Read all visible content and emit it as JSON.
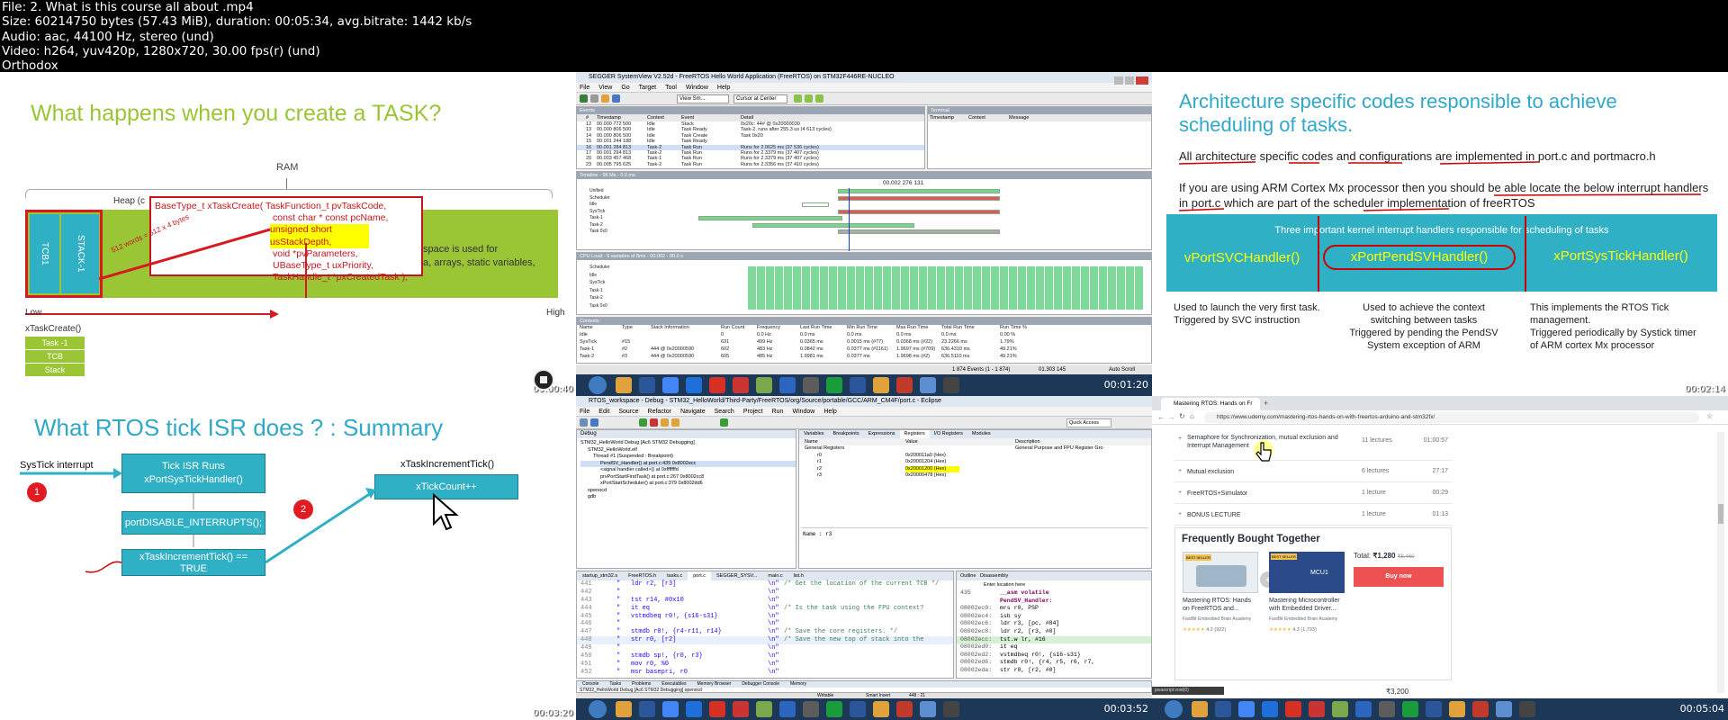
{
  "header": {
    "lines": [
      "File: 2. What is this course all about .mp4",
      "Size: 60214750 bytes (57.43 MiB), duration: 00:05:34, avg.bitrate: 1442 kb/s",
      "Audio: aac, 44100 Hz, stereo (und)",
      "Video: h264, yuv420p, 1280x720, 30.00 fps(r) (und)",
      "Orthodox"
    ]
  },
  "colors": {
    "slide_green": "#9ac534",
    "slide_blue": "#30b0c4",
    "taskbar": "#1d3757",
    "buy": "#ec5252",
    "arrow_red": "#d71920"
  },
  "thumb1": {
    "timestamp": "00:00:40",
    "title": "What happens when you create a TASK?",
    "ram": "RAM",
    "heap": "Heap (c",
    "tcb": "TCB1",
    "stack": "STACK-1",
    "code": [
      "BaseType_t xTaskCreate( TaskFunction_t pvTaskCode,",
      "const char * const pcName,",
      "unsigned short usStackDepth,",
      "void *pvParameters,",
      "UBaseType_t uxPriority,",
      "TaskHandle_t *pxCreatedTask );"
    ],
    "words": "512 words = 512 x 4 bytes",
    "space_text": [
      "space is used for",
      "a, arrays, static variables,"
    ],
    "low": "Low",
    "high": "High",
    "fn": "xTaskCreate()",
    "mini": [
      "Task -1",
      "TCB",
      "Stack"
    ]
  },
  "thumb2": {
    "timestamp": "00:01:20",
    "window_title": "SEGGER SystemView V2.52d - FreeRTOS Hello World Application (FreeRTOS) on STM32F446RE-NUCLEO",
    "menu": [
      "File",
      "View",
      "Go",
      "Target",
      "Tool",
      "Window",
      "Help"
    ],
    "toolbar_sel": "View Sm...",
    "toolbar_cur": "Cursor at Center",
    "events_title": "Events",
    "events_headers": [
      "#",
      "Timestamp",
      "Context",
      "Event",
      "Detail"
    ],
    "events": [
      [
        "12",
        "00.000 772 500",
        "Idle",
        "Stack",
        "0x20c: 44# @ 0x20000030"
      ],
      [
        "13",
        "00.000 806 500",
        "Idle",
        "Task Ready",
        "Task-2, runs after 255.3 us (4 613 cycles)"
      ],
      [
        "14",
        "00.000 806 500",
        "Idle",
        "Task Create",
        "Task 0x20"
      ],
      [
        "15",
        "00.001 244 188",
        "Idle",
        "Task Ready",
        ""
      ],
      [
        "16",
        "00.001 284 813",
        "Task-2",
        "Task Run",
        "Runs for 2.0625 ms (37 536 cycles)"
      ],
      [
        "17",
        "00.001 294 813",
        "Task-2",
        "Task Run",
        "Runs for 2.3379 ms (37 407 cycles)"
      ],
      [
        "20",
        "00.003 457 468",
        "Task-1",
        "Task Run",
        "Runs for 2.3379 ms (37 407 cycles)"
      ],
      [
        "23",
        "00.005 795 625",
        "Task-2",
        "Task Run",
        "Runs for 2.3356 ms (37 410 cycles)"
      ]
    ],
    "terminal_headers": [
      "Timestamp",
      "Context",
      "Message"
    ],
    "timeline_label": "Timeline - 96 Ms - 0.0 ms",
    "timeline_time": "00.002 276 131",
    "timeline_rows": [
      "Unified",
      "Scheduler",
      "Idle",
      "SysTick",
      "Task-1",
      "Task-2",
      "Task 0x0"
    ],
    "cpu_label": "CPU Load - 6 samples of 8ms - 00.002 - 00.0 s",
    "cpu_rows": [
      "Scheduler",
      "Idle",
      "SysTick",
      "Task-1",
      "Task-2",
      "Task 0x0"
    ],
    "contexts_title": "Contexts",
    "contexts_headers": [
      "Name",
      "Type",
      "Stack Information",
      "Run Count",
      "Frequency",
      "Last Run Time",
      "Min Run Time",
      "Max Run Time",
      "Total Run Time",
      "Run Time %"
    ],
    "contexts": [
      [
        "Idle",
        "",
        "",
        "0",
        "0.0 Hz",
        "0.0 ms",
        "0.0 ms",
        "0.0 ms",
        "0.0 ms",
        "0.00 %"
      ],
      [
        "SysTick",
        "#15",
        "",
        "631",
        "499 Hz",
        "0.0365 ms",
        "0.0015 ms (#77)",
        "0.0368 ms (#22)",
        "23.2266 ms",
        "1.79%"
      ],
      [
        "Task-1",
        "#2",
        "444 @ 0x20000590",
        "602",
        "483 Hz",
        "0.0842 ms",
        "0.0377 ms (#1161)",
        "1.9697 ms (#709)",
        "636.4310 ms",
        "49.21%"
      ],
      [
        "Task-2",
        "#3",
        "444 @ 0x20000590",
        "605",
        "485 Hz",
        "1.9981 ms",
        "0.0377 ms",
        "1.9698 ms (#2)",
        "636.5110 ms",
        "49.21%"
      ]
    ],
    "status": [
      "1 874 Events (1 - 1 874)",
      "01.303 145",
      "Auto Scroll"
    ]
  },
  "thumb3": {
    "timestamp": "00:02:14",
    "title": [
      "Architecture specific codes responsible to achieve",
      "scheduling of tasks."
    ],
    "p1": "All architecture specific codes and configurations are implemented in port.c and portmacro.h",
    "p2": "If you are using ARM Cortex Mx processor then you should be able locate the below interrupt handlers in port.c which are part of the scheduler implementation of freeRTOS",
    "box_title": "Three important kernel interrupt handlers responsible for scheduling of tasks",
    "handlers": [
      "vPortSVCHandler()",
      "xPortPendSVHandler()",
      "xPortSysTickHandler()"
    ],
    "desc1": [
      "Used to launch the very first task.",
      "Triggered by SVC instruction"
    ],
    "desc2": [
      "Used to achieve the context",
      "switching between tasks",
      "Triggered by pending the PendSV",
      "System exception of ARM"
    ],
    "desc3": [
      "This implements the RTOS Tick",
      "management.",
      "Triggered periodically by Systick timer",
      "of ARM cortex Mx processor"
    ]
  },
  "thumb4": {
    "timestamp": "00:03:20",
    "title": "What  RTOS tick ISR does ? : Summary",
    "systick": "SysTick interrupt",
    "n1": "1",
    "n2": "2",
    "box1": [
      "Tick ISR Runs",
      "xPortSysTickHandler()"
    ],
    "box2": "portDISABLE_INTERRUPTS();",
    "box3": [
      "xTaskIncrementTick() ==",
      "TRUE"
    ],
    "fn_label": "xTaskIncrementTick()",
    "box4": "xTickCount++"
  },
  "thumb5": {
    "timestamp": "00:03:52",
    "window_title": "RTOS_workspace - Debug - STM32_HelloWorld/Third-Party/FreeRTOS/org/Source/portable/GCC/ARM_CM4F/port.c - Eclipse",
    "menu": [
      "File",
      "Edit",
      "Source",
      "Refactor",
      "Navigate",
      "Search",
      "Project",
      "Run",
      "Window",
      "Help"
    ],
    "quick": "Quick Access",
    "debug_tab": "Debug",
    "tree": [
      "STM32_HelloWorld Debug [Ac6 STM32 Debugging]",
      "STM32_HelloWorld.elf",
      "Thread #1 (Suspended : Breakpoint)",
      "PendSV_Handler() at port.c:435 0x8002ecc",
      "<signal handler called>() at 0xfffffffd",
      "prvPortStartFirstTask() at port.c:267 0x8002cc8",
      "xPortStartScheduler() at port.c:379 0x8002dd6",
      "openocd",
      "gdb"
    ],
    "reg_tabs": [
      "Variables",
      "Breakpoints",
      "Expressions",
      "Registers",
      "I/O Registers",
      "Modules"
    ],
    "reg_headers": [
      "Name",
      "Value",
      "Description"
    ],
    "regs": [
      [
        "General Registers",
        "",
        "General Purpose and FPU Register Gro"
      ],
      [
        "r0",
        "0x200011a0 (Hex)",
        ""
      ],
      [
        "r1",
        "0x20001204 (Hex)",
        ""
      ],
      [
        "r2",
        "0x20001200 (Hex)",
        ""
      ],
      [
        "r3",
        "0x20000478 (Hex)",
        ""
      ]
    ],
    "name_field": "Name : r3",
    "file_tabs": [
      "startup_stm32.s",
      "FreeRTOS.h",
      "tasks.c",
      "port.c",
      "SEGGER_SYSV...",
      "main.c",
      "list.h"
    ],
    "code": [
      [
        "441",
        "ldr r2, [r3]"
      ],
      [
        "442",
        ""
      ],
      [
        "443",
        "tst r14, #0x10"
      ],
      [
        "444",
        "it eq"
      ],
      [
        "445",
        "vstmdbeq r0!, {s16-s31}"
      ],
      [
        "446",
        ""
      ],
      [
        "447",
        "stmdb r0!, {r4-r11, r14}"
      ],
      [
        "448",
        "str r0, [r2]"
      ],
      [
        "449",
        ""
      ],
      [
        "450",
        "stmdb sp!, {r0, r3}"
      ],
      [
        "451",
        "mov r0, %0"
      ],
      [
        "452",
        "msr basepri, r0"
      ]
    ],
    "comments": [
      "/* Get the location of the current TCB */",
      "/* Is the task using the FPU context?",
      "/* Save the core registers. */",
      "/* Save the new top of stack into the"
    ],
    "dis_tabs": [
      "Outline",
      "Disassembly"
    ],
    "dis_loc": "Enter location here",
    "dis": [
      [
        "435",
        "__asm volatile"
      ],
      [
        "",
        "PendSV_Handler:"
      ],
      [
        "08002ec0:",
        "mrs r0, PSP"
      ],
      [
        "08002ec4:",
        "isb sy"
      ],
      [
        "08002ec6:",
        "ldr r3, [pc, #84]"
      ],
      [
        "08002ec8:",
        "ldr r2, [r3, #0]"
      ],
      [
        "08002ecc:",
        "tst.w lr, #16"
      ],
      [
        "08002ed0:",
        "it eq"
      ],
      [
        "08002ed2:",
        "vstmdbeq r0!, {s16-s31}"
      ],
      [
        "08002ed6:",
        "stmdb r0!, {r4, r5, r6, r7,"
      ],
      [
        "08002eda:",
        "str r0, [r2, #0]"
      ]
    ],
    "console_tabs": [
      "Console",
      "Tasks",
      "Problems",
      "Executables",
      "Memory Browser",
      "Debugger Console",
      "Memory"
    ],
    "console_line": "STM32_HelloWorld Debug [Ac6 STM32 Debugging] openocd",
    "status": [
      "Writable",
      "Smart Insert",
      "448 : 21"
    ]
  },
  "thumb6": {
    "timestamp": "00:05:04",
    "tab": "Mastering RTOS: Hands on Fr",
    "url": "https://www.udemy.com/mastering-rtos-hands-on-with-freertos-arduino-and-stm32fx/",
    "sections": [
      {
        "name": "Semaphore for Synchronization, mutual exclusion and Interrupt Management",
        "lectures": "11 lectures",
        "time": "01:00:57"
      },
      {
        "name": "Mutual exclusion",
        "lectures": "6 lectures",
        "time": "27:17"
      },
      {
        "name": "FreeRTOS+Simulator",
        "lectures": "1 lecture",
        "time": "00:29"
      },
      {
        "name": "BONUS LECTURE",
        "lectures": "1 lecture",
        "time": "01:13"
      }
    ],
    "fbt": "Frequently Bought Together",
    "course1": [
      "Mastering RTOS: Hands",
      "on FreeRTOS and..."
    ],
    "course1_by": "FastBit Embedded Brain Academy",
    "course1_rating": "4.2 (922)",
    "course2": [
      "Mastering Microcontroller",
      "with Embedded Driver..."
    ],
    "course2_by": "FastBit Embedded Brain Academy",
    "course2_rating": "4.3 (1,793)",
    "mcu": "MCU1",
    "bestseller": "BEST SELLER",
    "total_label": "Total:",
    "total": "₹1,280",
    "old": "₹8,460",
    "buy": "Buy now",
    "price2": "₹3,200",
    "url_tip": "javascript:void(0)"
  }
}
